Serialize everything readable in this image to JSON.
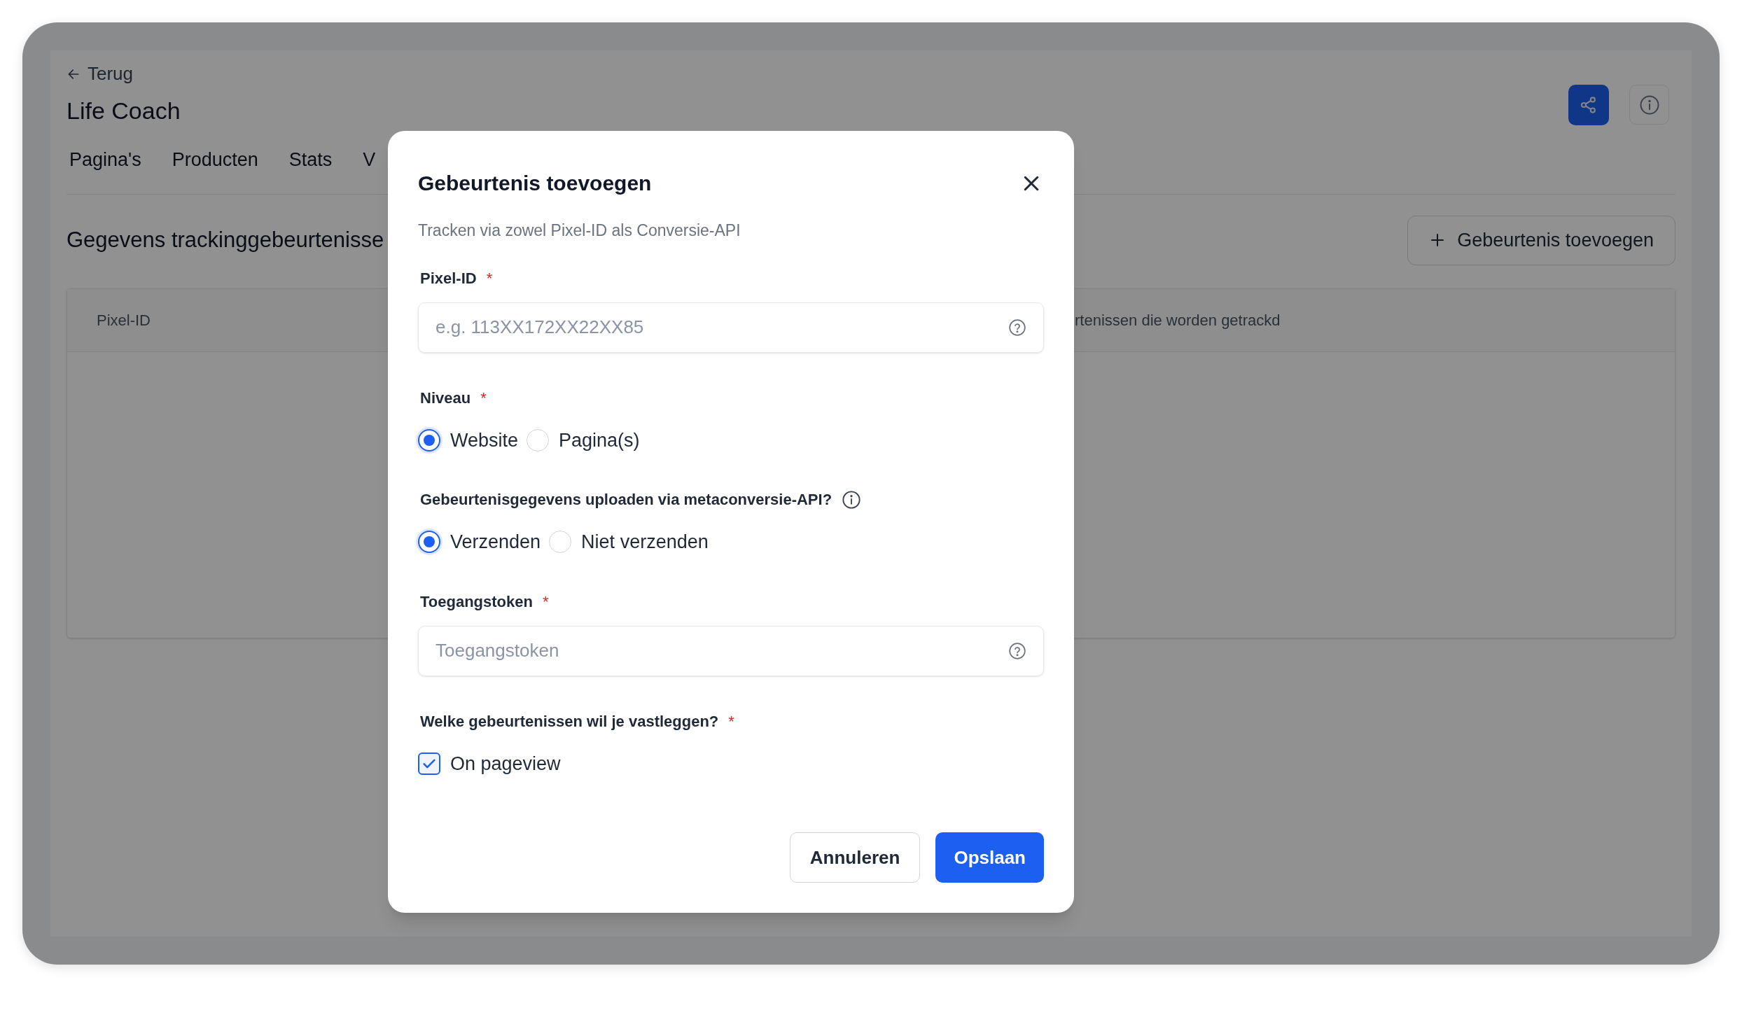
{
  "back_link": {
    "label": "Terug"
  },
  "page_title": "Life Coach",
  "tabs": [
    {
      "label": "Pagina's"
    },
    {
      "label": "Producten"
    },
    {
      "label": "Stats"
    },
    {
      "label": "V"
    }
  ],
  "section": {
    "title": "Gegevens trackinggebeurtenisse",
    "add_button": "Gebeurtenis toevoegen"
  },
  "table": {
    "columns": [
      "Pixel-ID",
      "rtenissen die worden getrackd"
    ]
  },
  "modal": {
    "title": "Gebeurtenis toevoegen",
    "subtitle": "Tracken via zowel Pixel-ID als Conversie-API",
    "fields": [
      {
        "kind": "text",
        "label": "Pixel-ID",
        "required_mark": "*",
        "placeholder": "e.g. 113XX172XX22XX85"
      },
      {
        "kind": "radio",
        "label": "Niveau",
        "required_mark": "*",
        "options": [
          {
            "label": "Website",
            "selected": true
          },
          {
            "label": "Pagina(s)",
            "selected": false
          }
        ]
      },
      {
        "kind": "radio",
        "label": "Gebeurtenisgegevens uploaden via metaconversie-API?",
        "info": true,
        "options": [
          {
            "label": "Verzenden",
            "selected": true
          },
          {
            "label": "Niet verzenden",
            "selected": false
          }
        ]
      },
      {
        "kind": "text",
        "label": "Toegangstoken",
        "required_mark": "*",
        "placeholder": "Toegangstoken"
      },
      {
        "kind": "checkbox",
        "label": "Welke gebeurtenissen wil je vastleggen?",
        "required_mark": "*",
        "options": [
          {
            "label": "On pageview",
            "checked": true
          }
        ]
      }
    ],
    "buttons": [
      {
        "kind": "secondary",
        "label": "Annuleren"
      },
      {
        "kind": "primary",
        "label": "Opslaan"
      }
    ]
  }
}
